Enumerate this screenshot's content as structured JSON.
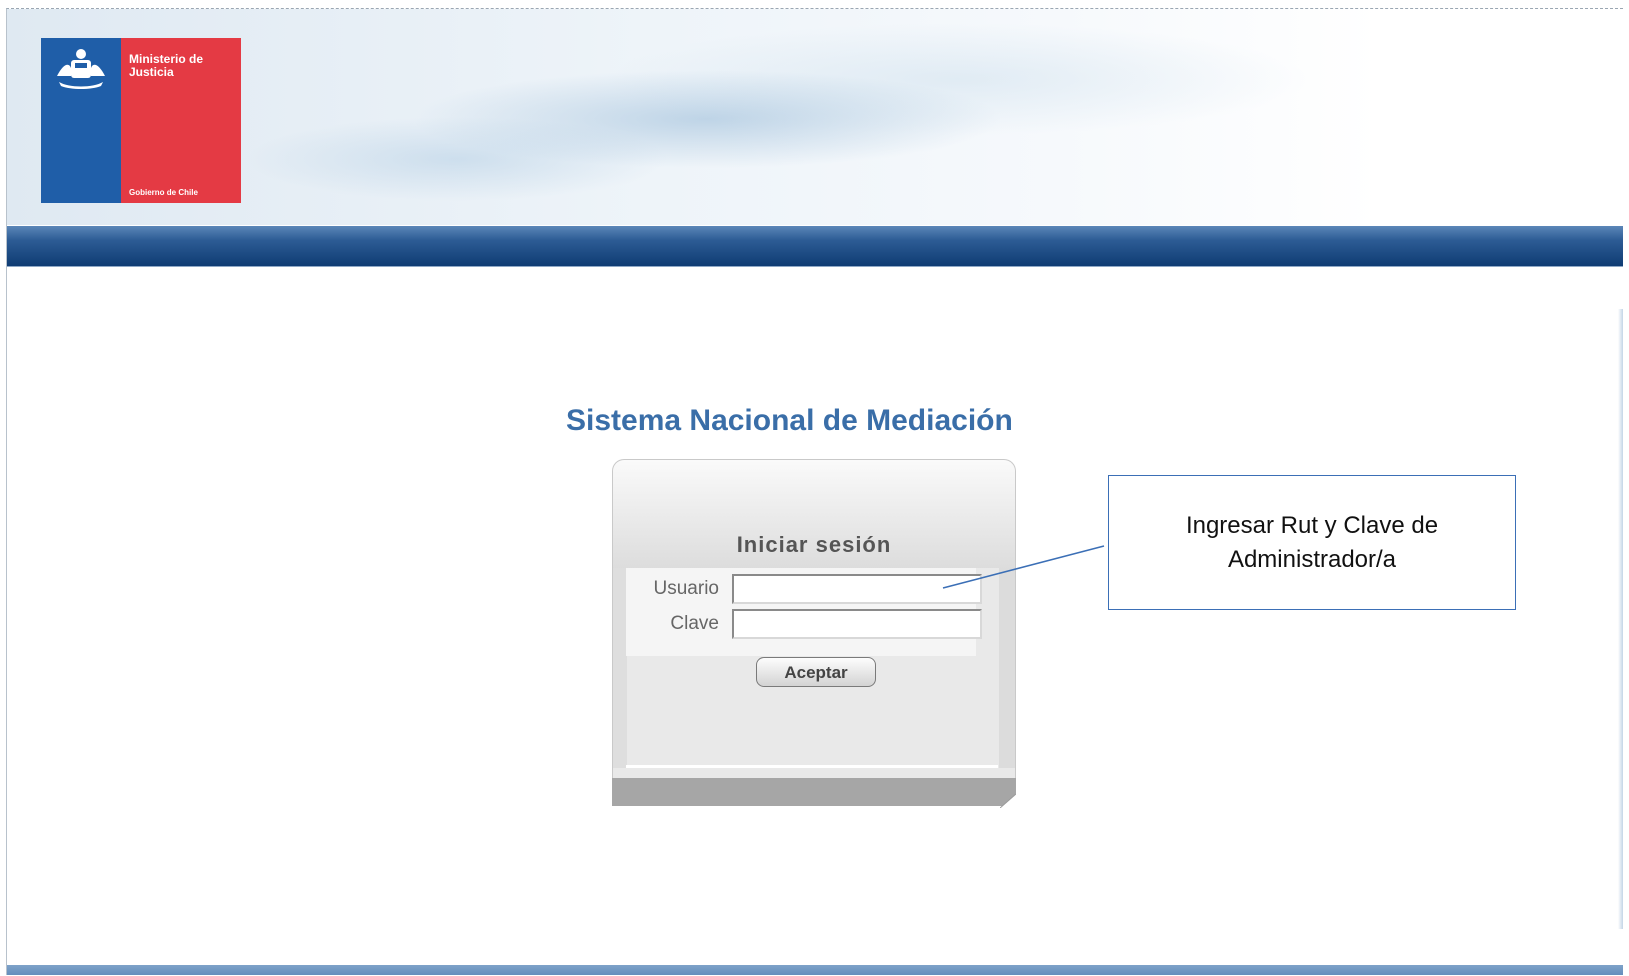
{
  "brand": {
    "ministry_name": "Ministerio de Justicia",
    "government": "Gobierno de Chile",
    "crest_icon": "chile-coat-of-arms-icon",
    "colors": {
      "blue": "#1f5ea8",
      "red": "#e43a44"
    }
  },
  "page": {
    "system_title": "Sistema Nacional de Mediación"
  },
  "login": {
    "heading": "Iniciar sesión",
    "user_label": "Usuario",
    "user_value": "",
    "password_label": "Clave",
    "password_value": "",
    "submit_label": "Aceptar"
  },
  "annotation": {
    "text": "Ingresar Rut y Clave de Administrador/a"
  },
  "colors": {
    "navbar": "#0f3c73",
    "title": "#3a6ea8",
    "callout_border": "#3b6fb6"
  }
}
